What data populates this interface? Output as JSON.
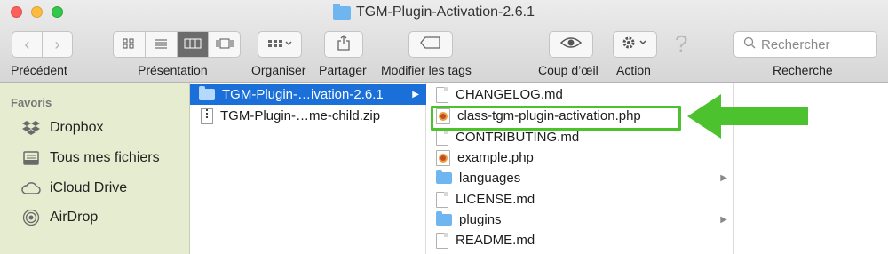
{
  "window": {
    "title": "TGM-Plugin-Activation-2.6.1"
  },
  "toolbar": {
    "nav": {
      "back_icon": "chevron-left-icon",
      "forward_icon": "chevron-right-icon",
      "label": "Précédent"
    },
    "presentation": {
      "label": "Présentation",
      "active_view": "columns"
    },
    "organize": {
      "label": "Organiser"
    },
    "share": {
      "label": "Partager"
    },
    "tags": {
      "label": "Modifier les tags"
    },
    "quicklook": {
      "label": "Coup d’œil"
    },
    "action": {
      "label": "Action"
    },
    "search": {
      "placeholder": "Rechercher",
      "label": "Recherche"
    }
  },
  "sidebar": {
    "header": "Favoris",
    "items": [
      {
        "label": "Dropbox",
        "icon": "dropbox-icon"
      },
      {
        "label": "Tous mes fichiers",
        "icon": "all-files-icon"
      },
      {
        "label": "iCloud Drive",
        "icon": "cloud-icon"
      },
      {
        "label": "AirDrop",
        "icon": "airdrop-icon"
      }
    ]
  },
  "column1": {
    "items": [
      {
        "label": "TGM-Plugin-…ivation-2.6.1",
        "type": "folder",
        "selected": true
      },
      {
        "label": "TGM-Plugin-…me-child.zip",
        "type": "zip",
        "selected": false
      }
    ]
  },
  "column2": {
    "items": [
      {
        "label": "CHANGELOG.md",
        "type": "doc"
      },
      {
        "label": "class-tgm-plugin-activation.php",
        "type": "php",
        "highlighted": true
      },
      {
        "label": "CONTRIBUTING.md",
        "type": "doc"
      },
      {
        "label": "example.php",
        "type": "php"
      },
      {
        "label": "languages",
        "type": "folder"
      },
      {
        "label": "LICENSE.md",
        "type": "doc"
      },
      {
        "label": "plugins",
        "type": "folder"
      },
      {
        "label": "README.md",
        "type": "doc"
      }
    ]
  },
  "colors": {
    "selection": "#1a6fd8",
    "sidebar": "#e6eccf",
    "highlight": "#4cc22e"
  }
}
